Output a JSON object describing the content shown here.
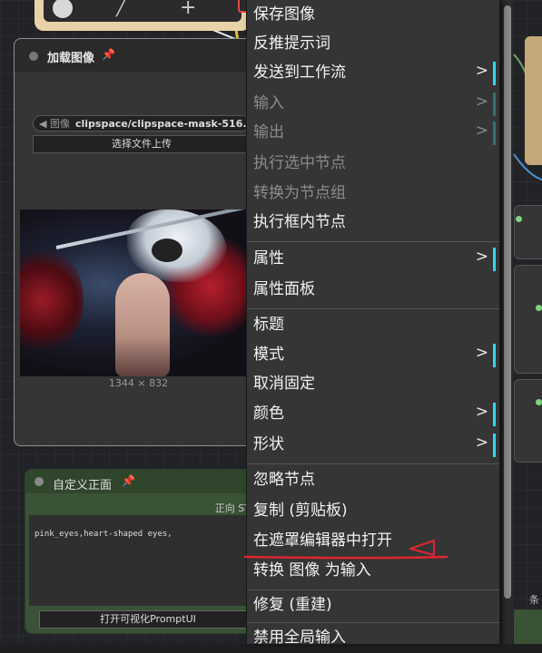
{
  "load_node": {
    "title": "加载图像",
    "combo_label": "◀ 图像",
    "combo_value": "clipspace/clipspace-mask-516...",
    "upload_button": "选择文件上传",
    "image_size": "1344 × 832"
  },
  "custom_node": {
    "title": "自定义正面",
    "positive_label": "正向 ST",
    "prompt_text": "pink_eyes,heart-shaped eyes,",
    "open_ui_button": "打开可视化PromptUI"
  },
  "right_side": {
    "green_node_label": "条"
  },
  "menu": {
    "items": [
      {
        "label": "保存图像"
      },
      {
        "label": "反推提示词"
      },
      {
        "label": "发送到工作流",
        "arrow": ">"
      },
      {
        "label": "输入",
        "arrow": ">"
      },
      {
        "label": "输出",
        "arrow": ">"
      },
      {
        "label": "执行选中节点"
      },
      {
        "label": "转换为节点组"
      },
      {
        "label": "执行框内节点"
      },
      {
        "label": "属性",
        "arrow": ">"
      },
      {
        "label": "属性面板"
      },
      {
        "label": "标题"
      },
      {
        "label": "模式",
        "arrow": ">"
      },
      {
        "label": "取消固定"
      },
      {
        "label": "颜色",
        "arrow": ">"
      },
      {
        "label": "形状",
        "arrow": ">"
      },
      {
        "label": "忽略节点"
      },
      {
        "label": "复制 (剪贴板)"
      },
      {
        "label": "在遮罩编辑器中打开"
      },
      {
        "label": "转换 图像 为输入"
      },
      {
        "label": "修复 (重建)"
      },
      {
        "label": "禁用全局输入"
      }
    ]
  },
  "colors": {
    "submenu_indicator": "#35d7e6",
    "annotation": "#e0262f",
    "menu_bg": "#353535"
  }
}
